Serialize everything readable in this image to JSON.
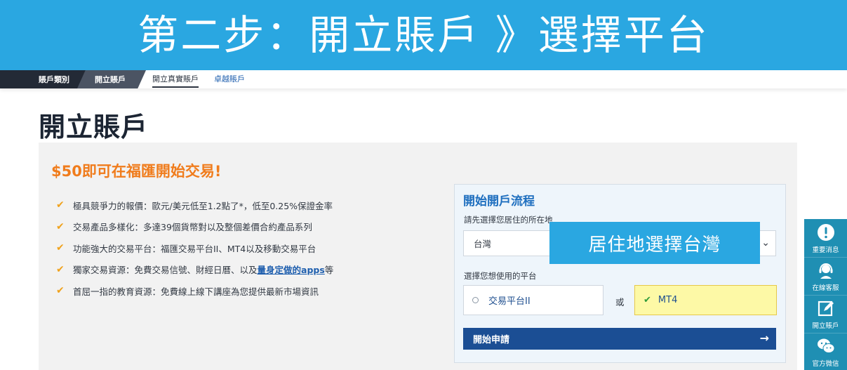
{
  "banner": {
    "title": "第二步：開立賬戶 》選擇平台"
  },
  "breadcrumb": {
    "items": [
      {
        "label": "賬戶類別"
      },
      {
        "label": "開立賬戶"
      },
      {
        "label": "開立真實賬戶"
      },
      {
        "label": "卓越賬戶"
      }
    ]
  },
  "page": {
    "title": "開立賬戶"
  },
  "promo": {
    "headline": "$50即可在福匯開始交易!"
  },
  "features": [
    {
      "text": "極具競爭力的報價：歐元/美元低至1.2點了*，低至0.25%保證金率"
    },
    {
      "text": "交易產品多樣化：多達39個貨幣對以及整個差價合約產品系列"
    },
    {
      "text": "功能強大的交易平台：福匯交易平台II、MT4以及移動交易平台"
    },
    {
      "text_before": "獨家交易資源：免費交易信號、財經日曆、以及",
      "link": "量身定做的apps",
      "text_after": "等"
    },
    {
      "text": "首屈一指的教育資源：免費線上線下講座為您提供最新市場資訊"
    }
  ],
  "form": {
    "title": "開始開戶流程",
    "country_label": "請先選擇您居住的所在地",
    "country_value": "台灣",
    "overlay_note": "居住地選擇台灣",
    "platform_label": "選擇您想使用的平台",
    "platform_options": [
      {
        "label": "交易平台II",
        "selected": false
      },
      {
        "label": "MT4",
        "selected": true
      }
    ],
    "or_text": "或",
    "submit_label": "開始申請",
    "submit_arrow": "→"
  },
  "sidebar": {
    "items": [
      {
        "label": "重要消息",
        "icon": "exclamation-icon"
      },
      {
        "label": "在線客服",
        "icon": "headset-icon"
      },
      {
        "label": "開立賬戶",
        "icon": "edit-icon"
      },
      {
        "label": "官方微信",
        "icon": "wechat-icon"
      }
    ]
  },
  "colors": {
    "banner": "#2aa7e1",
    "promo": "#f07c1c",
    "form_title": "#1f6fbf",
    "submit": "#1b4e94",
    "selected_option": "#fdf9a6",
    "sidebar": "#1f8fb3"
  }
}
